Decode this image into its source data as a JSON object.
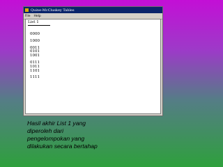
{
  "window": {
    "title": "Quine-McCluskey Tables",
    "menu": [
      "File",
      "Help"
    ]
  },
  "list": {
    "title": "List 1",
    "groups": [
      [
        "0000"
      ],
      [
        "1000"
      ],
      [
        "0011",
        "0101",
        "1001"
      ],
      [
        "0111",
        "1011",
        "1101"
      ],
      [
        "1111"
      ]
    ]
  },
  "caption": [
    "Hasil akhir List 1 yang",
    "diperoleh dari",
    "pengelompokan yang",
    "dilakukan secara bertahap"
  ]
}
